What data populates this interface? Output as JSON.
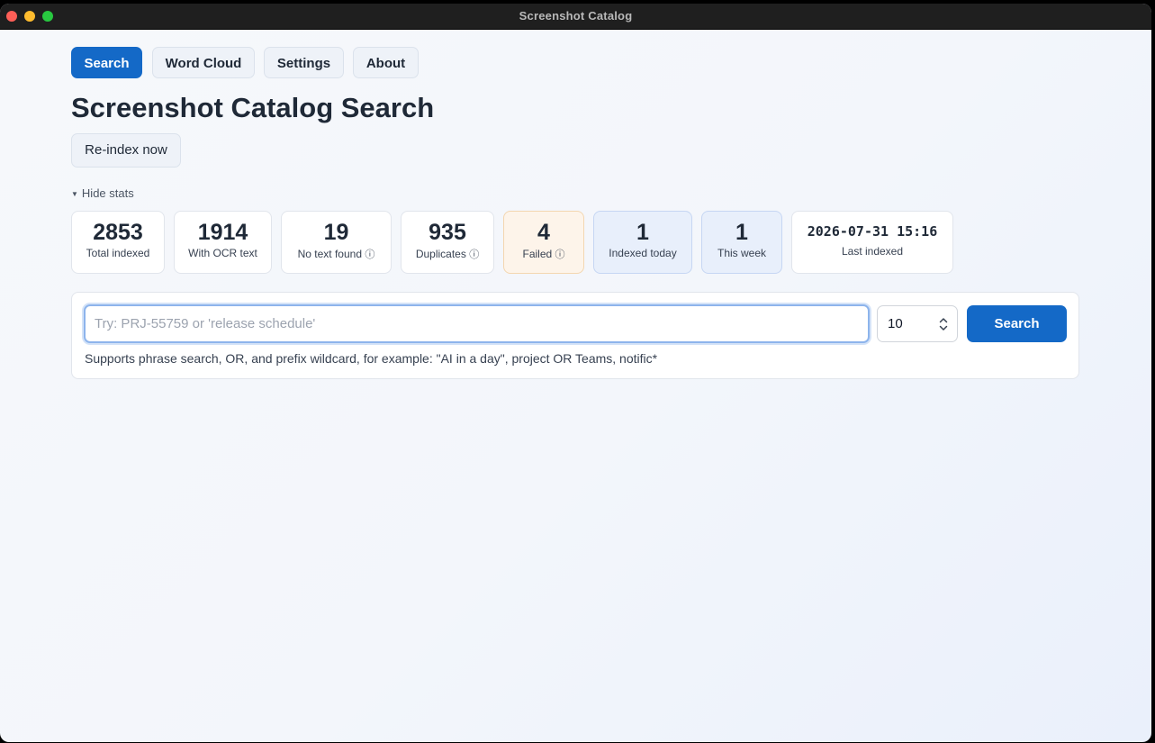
{
  "window": {
    "title": "Screenshot Catalog"
  },
  "nav": {
    "tabs": [
      {
        "label": "Search",
        "active": true
      },
      {
        "label": "Word Cloud",
        "active": false
      },
      {
        "label": "Settings",
        "active": false
      },
      {
        "label": "About",
        "active": false
      }
    ]
  },
  "page": {
    "title": "Screenshot Catalog Search",
    "reindex_label": "Re-index now",
    "toggle_stats_label": "Hide stats",
    "toggle_stats_icon": "caret-down-icon"
  },
  "stats": [
    {
      "value": "2853",
      "label": "Total indexed"
    },
    {
      "value": "1914",
      "label": "With OCR text"
    },
    {
      "value": "19",
      "label": "No text found",
      "info": "ⓘ"
    },
    {
      "value": "935",
      "label": "Duplicates",
      "info": "ⓘ"
    },
    {
      "value": "4",
      "label": "Failed",
      "info": "ⓘ",
      "tone": "warning"
    },
    {
      "value": "1",
      "label": "Indexed today",
      "tone": "info"
    },
    {
      "value": "1",
      "label": "This week",
      "tone": "info"
    },
    {
      "value": "2026-07-31 15:16",
      "label": "Last indexed"
    }
  ],
  "search": {
    "placeholder": "Try: PRJ-55759 or 'release schedule'",
    "value": "",
    "limit_value": "10",
    "button_label": "Search",
    "help_text": "Supports phrase search, OR, and prefix wildcard, for example: \"AI in a day\", project OR Teams, notific*"
  },
  "colors": {
    "accent": "#1469c7",
    "warning_bg": "#fdf4ea",
    "info_bg": "#e8effb",
    "close": "#ff5f57",
    "minimize": "#febc2e",
    "maximize": "#28c840"
  }
}
